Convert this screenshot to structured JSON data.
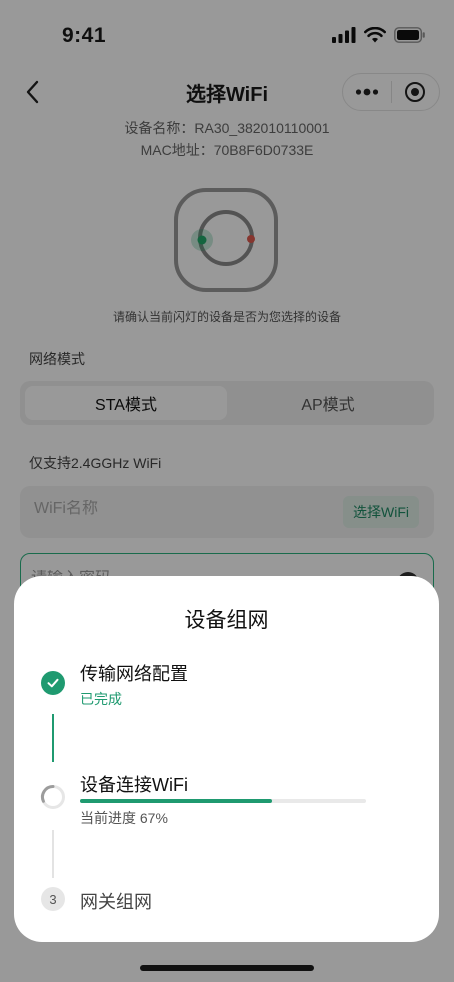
{
  "status_bar": {
    "time": "9:41"
  },
  "nav": {
    "title": "选择WiFi"
  },
  "device": {
    "name_line": "设备名称：RA30_382010110001",
    "mac_line": "MAC地址：70B8F6D0733E",
    "hint": "请确认当前闪灯的设备是否为您选择的设备"
  },
  "network_mode": {
    "label": "网络模式",
    "options": [
      "STA模式",
      "AP模式"
    ],
    "selected": "STA模式"
  },
  "wifi": {
    "support_note": "仅支持2.4GGHz WiFi",
    "name_placeholder": "WiFi名称",
    "choose_button": "选择WiFi",
    "password_placeholder": "请输入密码"
  },
  "modal": {
    "title": "设备组网",
    "steps": [
      {
        "index": "1",
        "title": "传输网络配置",
        "status": "已完成",
        "state": "done"
      },
      {
        "index": "2",
        "title": "设备连接WiFi",
        "status": "当前进度 67%",
        "state": "in_progress",
        "progress": 0.67
      },
      {
        "index": "3",
        "title": "网关组网",
        "state": "pending"
      }
    ]
  },
  "colors": {
    "accent": "#1f9a70",
    "accent_light": "#dfeee7",
    "led_green": "#20a96a",
    "led_red": "#e05a4f"
  }
}
